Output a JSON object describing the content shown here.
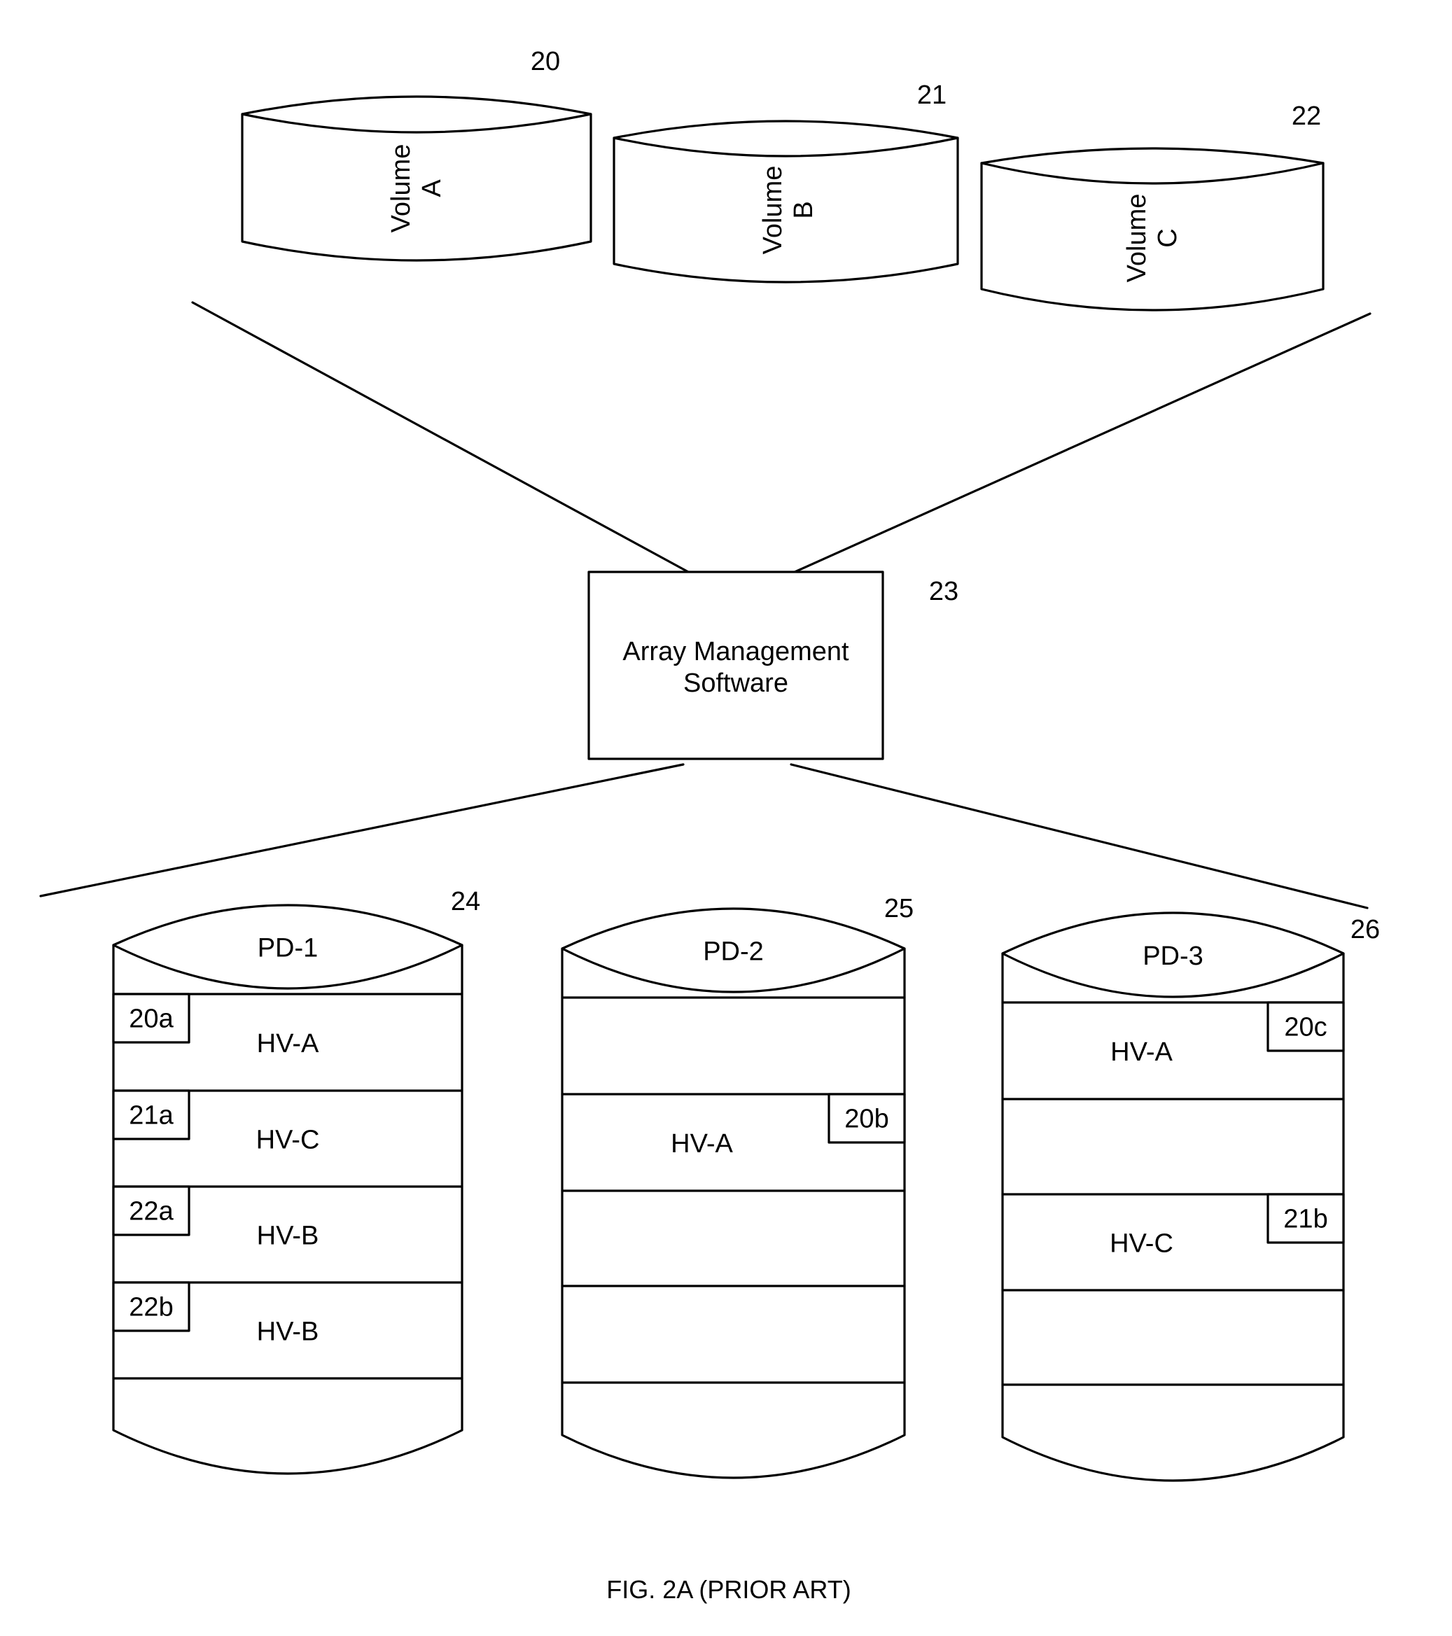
{
  "figure": {
    "caption": "FIG. 2A (PRIOR ART)",
    "colors": {
      "ink": "#000000",
      "paper": "#ffffff"
    }
  },
  "volumes": [
    {
      "ref": "20",
      "line1": "Volume",
      "line2": "A"
    },
    {
      "ref": "21",
      "line1": "Volume",
      "line2": "B"
    },
    {
      "ref": "22",
      "line1": "Volume",
      "line2": "C"
    }
  ],
  "manager": {
    "ref": "23",
    "line1": "Array Management",
    "line2": "Software"
  },
  "disks": [
    {
      "ref": "24",
      "name": "PD-1",
      "slots": [
        {
          "label": "HV-A",
          "tag": "20a"
        },
        {
          "label": "HV-C",
          "tag": "21a"
        },
        {
          "label": "HV-B",
          "tag": "22a"
        },
        {
          "label": "HV-B",
          "tag": "22b"
        },
        {
          "label": "",
          "tag": ""
        }
      ]
    },
    {
      "ref": "25",
      "name": "PD-2",
      "slots": [
        {
          "label": "",
          "tag": ""
        },
        {
          "label": "HV-A",
          "tag": "20b"
        },
        {
          "label": "",
          "tag": ""
        },
        {
          "label": "",
          "tag": ""
        },
        {
          "label": "",
          "tag": ""
        }
      ]
    },
    {
      "ref": "26",
      "name": "PD-3",
      "slots": [
        {
          "label": "HV-A",
          "tag": "20c"
        },
        {
          "label": "",
          "tag": ""
        },
        {
          "label": "HV-C",
          "tag": "21b"
        },
        {
          "label": "",
          "tag": ""
        },
        {
          "label": "",
          "tag": ""
        }
      ]
    }
  ]
}
